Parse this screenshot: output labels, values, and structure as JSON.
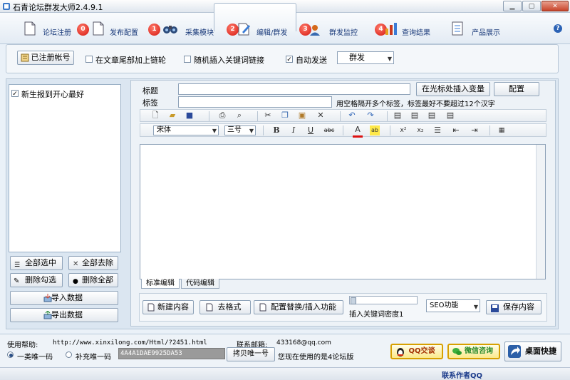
{
  "window": {
    "title": "石青论坛群发大师2.4.9.1"
  },
  "toolbar": {
    "items": [
      {
        "label": "论坛注册"
      },
      {
        "label": "发布配置",
        "badge": "0"
      },
      {
        "label": "采集模块",
        "badge": "1"
      },
      {
        "label": "编辑/群发",
        "badge": "2"
      },
      {
        "label": "群发监控",
        "badge": "3"
      },
      {
        "label": "查询结果",
        "badge": "4"
      },
      {
        "label": "产品展示"
      }
    ]
  },
  "options": {
    "registered_accounts_button": "已注册帐号",
    "append_link": {
      "label": "在文章尾部加上链轮",
      "checked": false
    },
    "random_keyword_link": {
      "label": "随机插入关键词链接",
      "checked": false
    },
    "auto_send": {
      "label": "自动发送",
      "checked": true
    },
    "mode_select": "群发"
  },
  "accounts": {
    "items": [
      {
        "label": "新生报到开心最好",
        "checked": true
      }
    ],
    "select_all": "全部选中",
    "deselect_all": "全部去除",
    "delete_checked": "删除勾选",
    "delete_all": "删除全部",
    "import": "导入数据",
    "export": "导出数据"
  },
  "editor": {
    "title_label": "标题",
    "tags_label": "标签",
    "insert_variable_button": "在光标处插入变量",
    "config_button": "配置",
    "tags_hint": "用空格隔开多个标签，标签最好不要超过12个汉字",
    "font_name": "宋体",
    "font_size": "三号",
    "tabs": [
      "标准编辑",
      "代码编辑"
    ],
    "new_content": "新建内容",
    "remove_format": "去格式",
    "replace_insert": "配置替换/插入功能",
    "keyword_density": "插入关键词密度1",
    "seo_select": "SEO功能",
    "save_content": "保存内容"
  },
  "footer": {
    "help_label": "使用帮助:",
    "help_url": "http://www.xinxilong.com/Html/?2451.html",
    "email_label": "联系邮箱:",
    "email": "433168@qq.com",
    "radio_one": "一类唯一码",
    "radio_two": "补充唯一码",
    "unique_code": "4A4A1DAE9925DA53",
    "copy_code_button": "拷贝唯一号",
    "version_msg": "您现在使用的是4论坛版",
    "qq_chat": "QQ交谈",
    "wechat": "微信咨询",
    "desktop_shortcut": "桌面快捷",
    "contact_author": "联系作者QQ"
  },
  "colors": {
    "badge": "#d4140d",
    "link": "#1a3a7a",
    "accent": "#2b62b5"
  }
}
